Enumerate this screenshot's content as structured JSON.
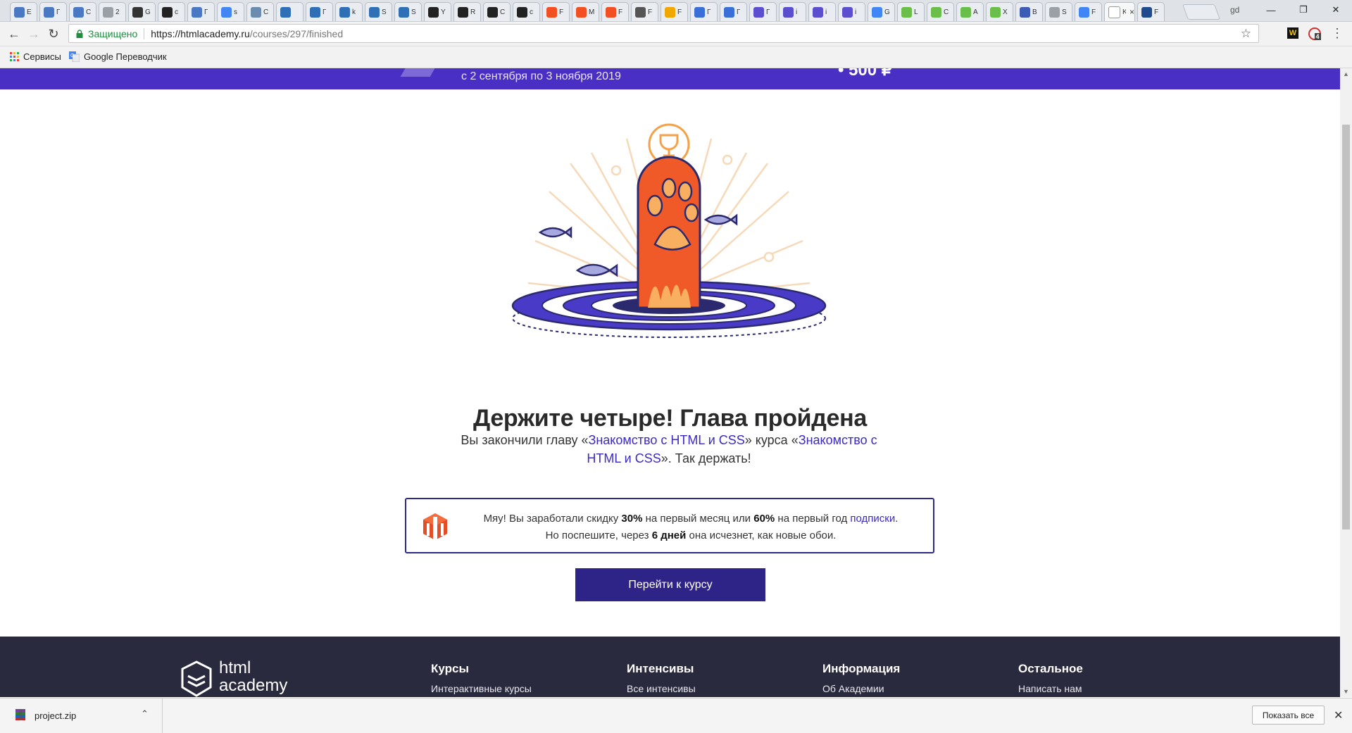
{
  "browser": {
    "tabs": [
      {
        "label": "E",
        "icon": "page-icon",
        "color": "#4a78c2"
      },
      {
        "label": "Г",
        "icon": "page-icon",
        "color": "#4a78c2"
      },
      {
        "label": "С",
        "icon": "page-icon",
        "color": "#4a78c2"
      },
      {
        "label": "2",
        "icon": "doc-icon",
        "color": "#9aa0a6"
      },
      {
        "label": "G",
        "icon": "github-icon",
        "color": "#333333"
      },
      {
        "label": "c",
        "icon": "glasses-icon",
        "color": "#222222"
      },
      {
        "label": "Г",
        "icon": "page-icon",
        "color": "#4a78c2"
      },
      {
        "label": "s",
        "icon": "google-icon",
        "color": "#4285f4"
      },
      {
        "label": "С",
        "icon": "hexlet-icon",
        "color": "#6b8cae"
      },
      {
        "label": "",
        "icon": "monitor-icon",
        "color": "#2f6fb5"
      },
      {
        "label": "Г",
        "icon": "monitor-icon",
        "color": "#2f6fb5"
      },
      {
        "label": "k",
        "icon": "monitor-icon",
        "color": "#2f6fb5"
      },
      {
        "label": "S",
        "icon": "monitor-icon",
        "color": "#2f6fb5"
      },
      {
        "label": "S",
        "icon": "monitor-icon",
        "color": "#2f6fb5"
      },
      {
        "label": "Y",
        "icon": "r-icon",
        "color": "#222222"
      },
      {
        "label": "R",
        "icon": "r-icon",
        "color": "#222222"
      },
      {
        "label": "С",
        "icon": "r-icon",
        "color": "#222222"
      },
      {
        "label": "c",
        "icon": "glasses-icon",
        "color": "#222222"
      },
      {
        "label": "F",
        "icon": "windows-icon",
        "color": "#f25022"
      },
      {
        "label": "M",
        "icon": "windows-icon",
        "color": "#f25022"
      },
      {
        "label": "F",
        "icon": "windows-icon",
        "color": "#f25022"
      },
      {
        "label": "F",
        "icon": "hat-icon",
        "color": "#555555"
      },
      {
        "label": "F",
        "icon": "p-icon",
        "color": "#f0a800"
      },
      {
        "label": "Г",
        "icon": "network-icon",
        "color": "#3a6fd8"
      },
      {
        "label": "Г",
        "icon": "network-icon",
        "color": "#3a6fd8"
      },
      {
        "label": "Г",
        "icon": "wave-icon",
        "color": "#5b4fd0"
      },
      {
        "label": "i",
        "icon": "wave-icon",
        "color": "#5b4fd0"
      },
      {
        "label": "i",
        "icon": "wave-icon",
        "color": "#5b4fd0"
      },
      {
        "label": "i",
        "icon": "wave-icon",
        "color": "#5b4fd0"
      },
      {
        "label": "G",
        "icon": "google-icon",
        "color": "#4285f4"
      },
      {
        "label": "L",
        "icon": "leaf-icon",
        "color": "#6abf4b"
      },
      {
        "label": "C",
        "icon": "leaf-icon",
        "color": "#6abf4b"
      },
      {
        "label": "A",
        "icon": "leaf-icon",
        "color": "#6abf4b"
      },
      {
        "label": "X",
        "icon": "leaf-icon",
        "color": "#6abf4b"
      },
      {
        "label": "B",
        "icon": "circle-icon",
        "color": "#3c5bb5"
      },
      {
        "label": "S",
        "icon": "doc-icon",
        "color": "#9aa0a6"
      },
      {
        "label": "F",
        "icon": "google-icon",
        "color": "#4285f4"
      },
      {
        "label": "K",
        "icon": "htmlacademy-icon",
        "color": "#ffffff",
        "active": true
      },
      {
        "label": "F",
        "icon": "e-icon",
        "color": "#1f4b8c"
      }
    ],
    "profile": "gd",
    "address": {
      "secure_label": "Защищено",
      "url_host": "https://htmlacademy.ru",
      "url_path": "/courses/297/finished"
    },
    "extensions": [
      {
        "name": "wappalyzer-icon",
        "label": "W",
        "bg": "#111111",
        "fg": "#f3c316"
      },
      {
        "name": "opera-icon",
        "label": "4",
        "bg": "#ffffff",
        "fg": "#d32f2f"
      }
    ],
    "bookmarks": [
      {
        "label": "Сервисы",
        "icon": "apps-icon"
      },
      {
        "label": "Google Переводчик",
        "icon": "translate-icon"
      }
    ]
  },
  "page": {
    "banner_date": "с 2 сентября по 3 ноября 2019",
    "banner_price": "• 500 ₽",
    "title": "Держите четыре! Глава пройдена",
    "desc": {
      "p1": "Вы закончили главу «",
      "chapter": "Знакомство с HTML и CSS",
      "p2": "» курса «",
      "course": "Знакомство с HTML и CSS",
      "p3": "». Так держать!"
    },
    "promo": {
      "t1": "Мяу! Вы заработали скидку ",
      "d1": "30%",
      "t2": " на первый месяц или ",
      "d2": "60%",
      "t3": " на первый год ",
      "link": "подписки",
      "t4": ".",
      "t5": "Но поспешите, через ",
      "days": "6 дней",
      "t6": " она исчезнет, как новые обои."
    },
    "cta": "Перейти к курсу",
    "footer": {
      "logo_line1": "html",
      "logo_line2": "academy",
      "columns": [
        {
          "heading": "Курсы",
          "link": "Интерактивные курсы"
        },
        {
          "heading": "Интенсивы",
          "link": "Все интенсивы"
        },
        {
          "heading": "Информация",
          "link": "Об Академии"
        },
        {
          "heading": "Остальное",
          "link": "Написать нам"
        }
      ]
    }
  },
  "downloads": {
    "file": "project.zip",
    "show_all": "Показать все"
  },
  "colors": {
    "accent": "#4a2fc4",
    "link": "#3b2bc0",
    "button": "#2e2488",
    "footer": "#2a2a3e",
    "paw": "#f05a28"
  }
}
